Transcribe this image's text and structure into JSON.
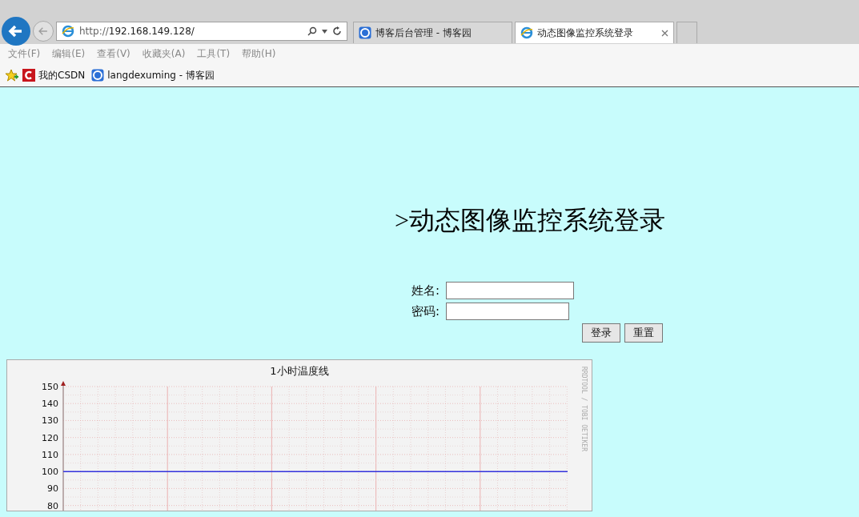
{
  "browser": {
    "nav": [
      {
        "kind": "back",
        "disabled": false
      },
      {
        "kind": "forward",
        "disabled": true
      }
    ],
    "address": {
      "scheme": "http://",
      "host": "192.168.149.128/"
    },
    "tabs": [
      {
        "title": "博客后台管理 - 博客园",
        "kind": "blog",
        "selected": false
      },
      {
        "title": "动态图像监控系统登录",
        "kind": "ie",
        "selected": true
      }
    ],
    "menu": [
      "文件(F)",
      "编辑(E)",
      "查看(V)",
      "收藏夹(A)",
      "工具(T)",
      "帮助(H)"
    ],
    "favorites": [
      {
        "label": "我的CSDN",
        "kind": "csdn"
      },
      {
        "label": "langdexuming - 博客园",
        "kind": "blog"
      }
    ]
  },
  "page": {
    "title": ">动态图像监控系统登录",
    "fields": [
      {
        "label": "姓名:",
        "kind": "text"
      },
      {
        "label": "密码:",
        "kind": "password"
      }
    ],
    "buttons": [
      "登录",
      "重置"
    ],
    "chart_data": {
      "type": "line",
      "title": "1小时温度线",
      "ylim": [
        77,
        150
      ],
      "grid": true,
      "yticks": [
        80,
        90,
        100,
        110,
        120,
        130,
        140,
        150
      ],
      "series": [
        {
          "color": "#3333dd",
          "values": [
            100,
            100,
            100,
            100,
            100,
            100,
            100,
            100,
            100,
            100,
            100
          ]
        }
      ],
      "annotations": [
        "RRDTOOL / TOBI OETIKER"
      ]
    }
  }
}
